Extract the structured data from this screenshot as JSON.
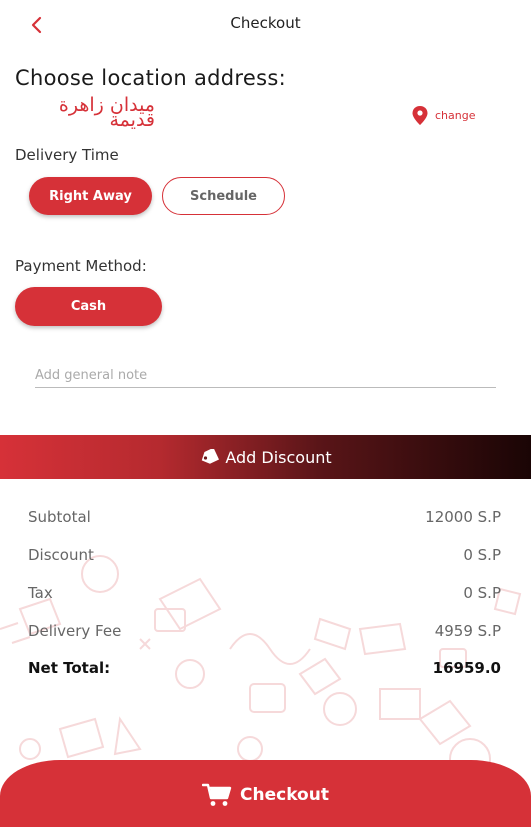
{
  "header": {
    "title": "Checkout",
    "back_icon": "chevron-left-icon"
  },
  "location": {
    "heading": "Choose location address:",
    "name": "ميدان زاهرة قديمة",
    "change_label": "change",
    "change_icon": "map-pin-icon"
  },
  "delivery": {
    "label": "Delivery Time",
    "options": [
      {
        "label": "Right Away",
        "selected": true
      },
      {
        "label": "Schedule",
        "selected": false
      }
    ]
  },
  "payment": {
    "label": "Payment Method:",
    "options": [
      {
        "label": "Cash",
        "selected": true
      }
    ]
  },
  "note": {
    "placeholder": "Add general note",
    "value": ""
  },
  "discount": {
    "label": "Add Discount",
    "icon": "tag-icon"
  },
  "summary": {
    "rows": [
      {
        "label": "Subtotal",
        "value": "12000 S.P"
      },
      {
        "label": "Discount",
        "value": "0 S.P"
      },
      {
        "label": "Tax",
        "value": "0 S.P"
      },
      {
        "label": "Delivery Fee",
        "value": "4959 S.P"
      }
    ],
    "total": {
      "label": "Net Total:",
      "value": "16959.0"
    }
  },
  "checkout_button": {
    "label": "Checkout",
    "icon": "cart-icon"
  },
  "colors": {
    "accent": "#d63138",
    "text": "#222222",
    "muted": "#666666"
  }
}
